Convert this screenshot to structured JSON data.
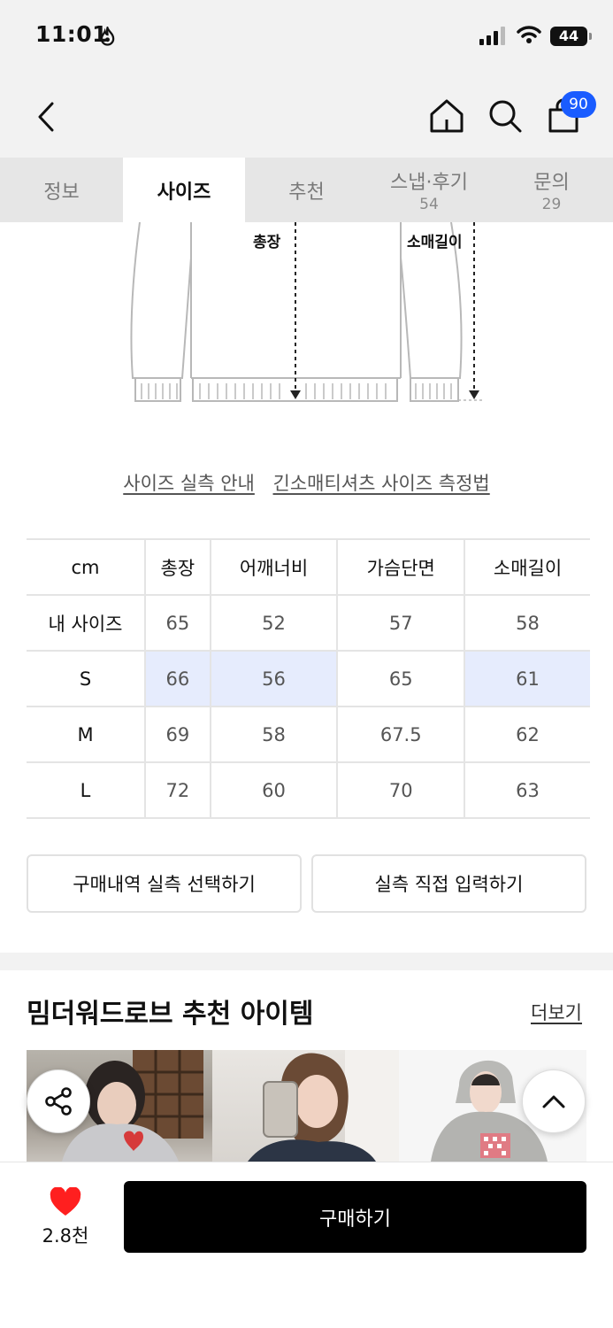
{
  "status": {
    "time": "11:01",
    "battery": "44"
  },
  "nav": {
    "cart_count": "90"
  },
  "tabs": [
    {
      "label": "정보",
      "count": ""
    },
    {
      "label": "사이즈",
      "count": ""
    },
    {
      "label": "추천",
      "count": ""
    },
    {
      "label": "스냅·후기",
      "count": "54"
    },
    {
      "label": "문의",
      "count": "29"
    }
  ],
  "diagram": {
    "length_label": "총장",
    "sleeve_label": "소매길이"
  },
  "links": {
    "guide": "사이즈 실측 안내",
    "method": "긴소매티셔츠 사이즈 측정법"
  },
  "size_table": {
    "headers": [
      "cm",
      "총장",
      "어깨너비",
      "가슴단면",
      "소매길이"
    ],
    "rows": [
      {
        "label": "내 사이즈",
        "values": [
          "65",
          "52",
          "57",
          "58"
        ]
      },
      {
        "label": "S",
        "values": [
          "66",
          "56",
          "65",
          "61"
        ]
      },
      {
        "label": "M",
        "values": [
          "69",
          "58",
          "67.5",
          "62"
        ]
      },
      {
        "label": "L",
        "values": [
          "72",
          "60",
          "70",
          "63"
        ]
      }
    ]
  },
  "actions": {
    "select_history": "구매내역 실측 선택하기",
    "manual_input": "실측 직접 입력하기"
  },
  "recommend": {
    "title": "밈더워드로브 추천 아이템",
    "more": "더보기"
  },
  "bottom": {
    "likes": "2.8천",
    "buy": "구매하기",
    "heart_color": "#ff1f1f"
  },
  "colors": {
    "accent": "#1a5cff",
    "highlight": "#e6ecfd"
  }
}
